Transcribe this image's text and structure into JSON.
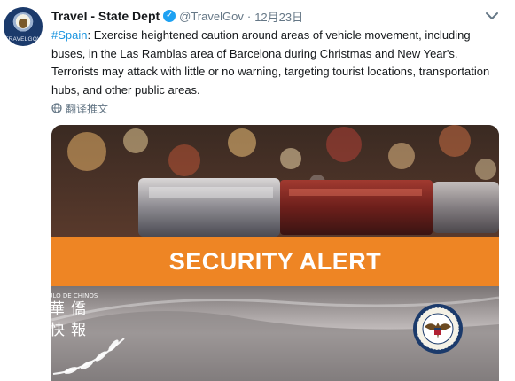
{
  "tweet": {
    "display_name": "Travel - State Dept",
    "handle": "@TravelGov",
    "separator": "·",
    "date": "12月23日",
    "hashtag": "#Spain",
    "body": ": Exercise heightened caution around areas of vehicle movement, including buses, in the Las Ramblas area of Barcelona during  Christmas and New Year's. Terrorists may attack with little or no warning, targeting tourist locations, transportation hubs, and other public areas.",
    "translate_label": "翻译推文",
    "avatar_caption": "TRAVELGOV"
  },
  "card": {
    "banner_text": "SECURITY ALERT",
    "banner_color": "#ee8524",
    "seal_icon": "us-department-of-state-seal-icon"
  },
  "watermark": {
    "chars": [
      "華",
      "僑",
      "快",
      "報"
    ],
    "arc_text": "CIRCULO DE CHINOS",
    "icon": "laurel-wreath-icon"
  },
  "colors": {
    "link": "#1b95e0",
    "verified": "#1da1f2",
    "muted": "#657786"
  },
  "icons": [
    "verified-badge-icon",
    "chevron-down-icon",
    "globe-icon"
  ]
}
